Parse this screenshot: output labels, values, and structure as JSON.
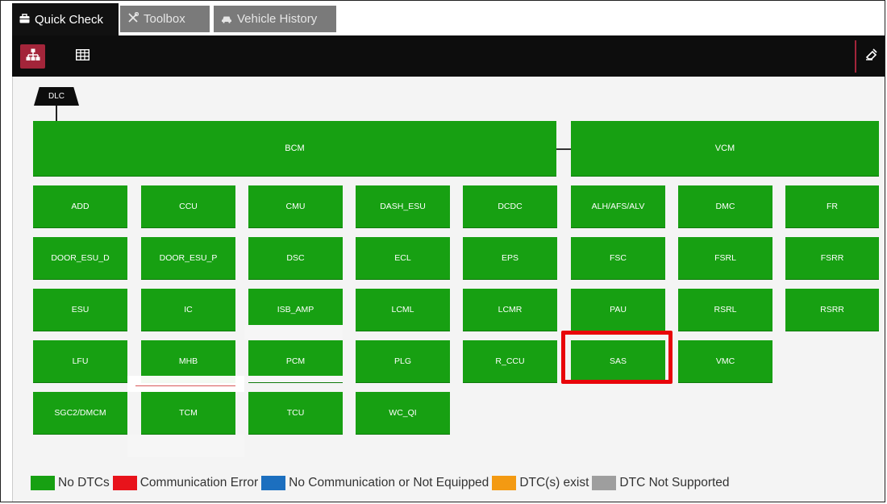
{
  "tabs": [
    {
      "label": "Quick Check",
      "icon": "toolbox-icon",
      "active": true
    },
    {
      "label": "Toolbox",
      "icon": "tools-icon",
      "active": false
    },
    {
      "label": "Vehicle History",
      "icon": "car-icon",
      "active": false
    }
  ],
  "toolbar": {
    "tree_view": "network-tree-icon",
    "grid_view": "grid-table-icon",
    "clear": "eraser-icon"
  },
  "network": {
    "connector": "DLC",
    "buses": [
      "BCM",
      "VCM"
    ],
    "modules": {
      "row1": [
        "ADD",
        "CCU",
        "CMU",
        "DASH_ESU",
        "DCDC",
        "ALH/AFS/ALV",
        "DMC",
        "FR"
      ],
      "row2": [
        "DOOR_ESU_D",
        "DOOR_ESU_P",
        "DSC",
        "ECL",
        "EPS",
        "FSC",
        "FSRL",
        "FSRR"
      ],
      "row3": [
        "ESU",
        "IC",
        "ISB_AMP",
        "LCML",
        "LCMR",
        "PAU",
        "RSRL",
        "RSRR"
      ],
      "row4": [
        "LFU",
        "MHB",
        "PCM",
        "PLG",
        "R_CCU",
        "SAS",
        "VMC"
      ],
      "row5": [
        "SGC2/DMCM",
        "TCM",
        "TCU",
        "WC_QI"
      ]
    },
    "selected": "SAS"
  },
  "legend": [
    {
      "label": "No DTCs",
      "color": "#17a012"
    },
    {
      "label": "Communication Error",
      "color": "#e8131b"
    },
    {
      "label": "No Communication or Not Equipped",
      "color": "#1c6fbf"
    },
    {
      "label": "DTC(s) exist",
      "color": "#f39a12"
    },
    {
      "label": "DTC Not Supported",
      "color": "#9e9e9e"
    }
  ],
  "colors": {
    "ok": "#17a012",
    "selection": "#e8050a",
    "accent": "#a3253a"
  }
}
